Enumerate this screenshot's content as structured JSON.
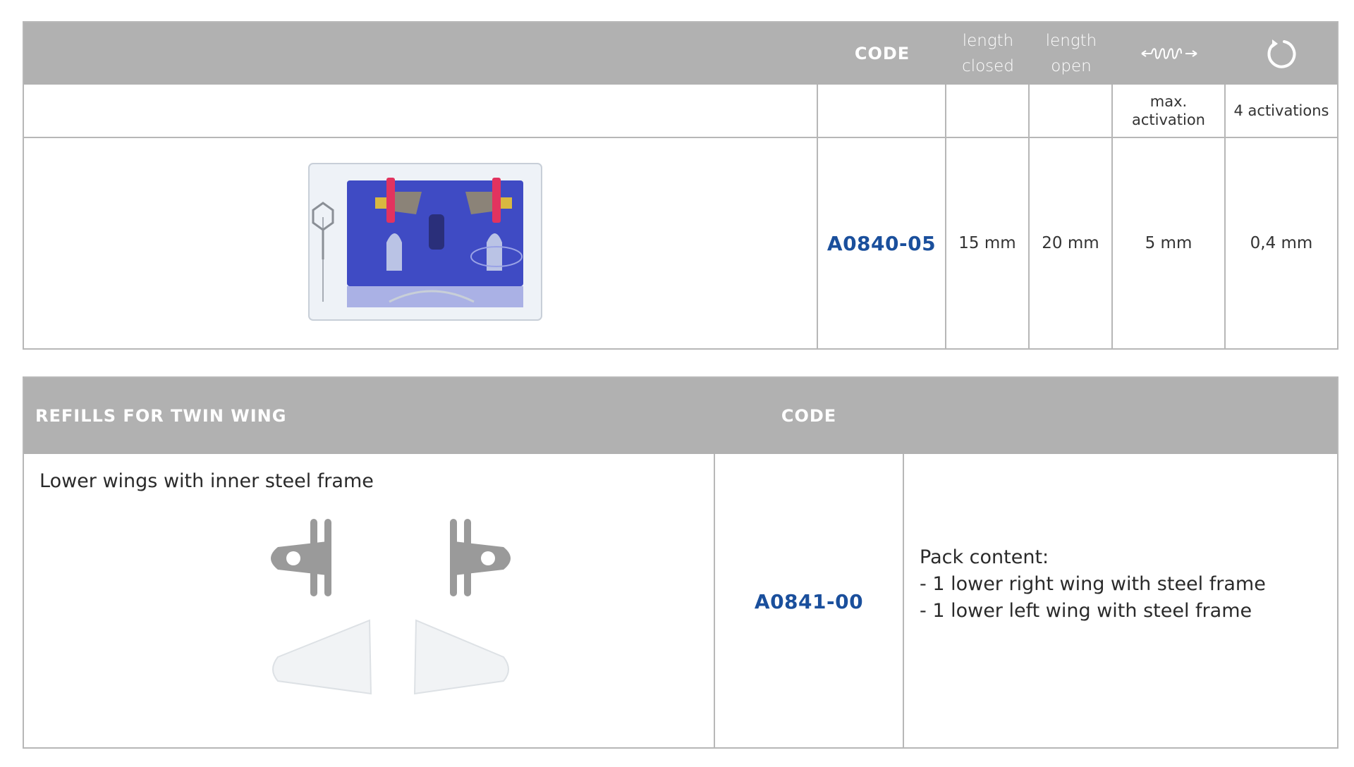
{
  "table1": {
    "header": {
      "code_label": "CODE",
      "length_closed_line1": "length",
      "length_closed_line2": "closed",
      "length_open_line1": "length",
      "length_open_line2": "open",
      "spring_icon": "spring-icon",
      "rotate_icon": "rotate-icon"
    },
    "subheader": {
      "max_activation_line1": "max.",
      "max_activation_line2": "activation",
      "activations": "4 activations"
    },
    "row": {
      "product_image": "product-box-image",
      "code": "A0840-05",
      "length_closed": "15 mm",
      "length_open": "20 mm",
      "max_activation": "5 mm",
      "activation_4": "0,4 mm"
    }
  },
  "table2": {
    "header": {
      "title": "REFILLS FOR TWIN WING",
      "code_label": "CODE"
    },
    "row": {
      "description": "Lower wings with inner steel frame",
      "code": "A0841-00",
      "pack_title": "Pack content:",
      "pack_items": [
        "- 1 lower right wing with steel frame",
        "- 1 lower left wing with steel frame"
      ]
    }
  },
  "colors": {
    "header_bg": "#b1b1b1",
    "border": "#b7b7b7",
    "code_blue": "#1a4f9c"
  }
}
